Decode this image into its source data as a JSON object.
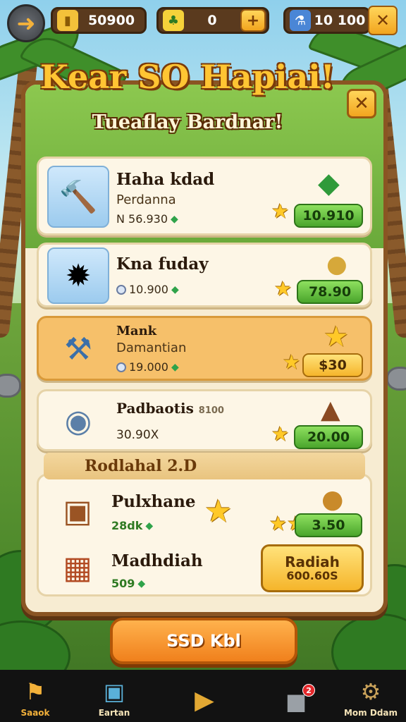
{
  "topbar": {
    "back_icon": "back-arrow-icon",
    "resources": [
      {
        "icon": "gold-bar-icon",
        "value": "50900"
      },
      {
        "icon": "corn-icon",
        "value": "0"
      },
      {
        "icon": "potion-icon",
        "value": "10 100"
      }
    ],
    "plus_label": "+",
    "close_label": "✕"
  },
  "panel": {
    "title": "Kear SO Hapiai!",
    "subtitle": "Tueaflay Bardnar!",
    "close_label": "✕"
  },
  "items": [
    {
      "name": "Haha kdad",
      "sub": "Perdanna",
      "cost": "N 56.930",
      "price": "10.910",
      "icon": "hammer-tool-icon"
    },
    {
      "name": "Kna fuday",
      "sub": "",
      "cost": "10.900",
      "price": "78.90",
      "icon": "orange-crystal-icon"
    },
    {
      "name": "Mank",
      "sub": "Damantian",
      "cost": "19.000",
      "price": "$30",
      "icon": "crossed-tools-icon"
    },
    {
      "name": "Padbaotis",
      "sub": "8100",
      "cost": "30.90X",
      "price": "20.00",
      "icon": "round-shield-icon"
    }
  ],
  "section_banner": "Rodlahal 2.D",
  "bottom_items": [
    {
      "name": "Pulxhane",
      "cost": "28dk",
      "price": "3.50",
      "icon": "treasure-barrel-icon"
    },
    {
      "name": "Madhdiah",
      "cost": "509",
      "icon": "treasure-chest-icon"
    }
  ],
  "radiah_button": {
    "line1": "Radiah",
    "line2": "600.60S"
  },
  "main_button": "SSD Kbl",
  "nav": [
    {
      "label": "Saaok",
      "icon": "flag-icon",
      "badge": ""
    },
    {
      "label": "Eartan",
      "icon": "cube-box-icon",
      "badge": ""
    },
    {
      "label": "",
      "icon": "play-triangle-icon",
      "badge": ""
    },
    {
      "label": "",
      "icon": "camera-icon",
      "badge": "2"
    },
    {
      "label": "Mom Ddam",
      "icon": "gear-icon",
      "badge": ""
    }
  ],
  "colors": {
    "panel_border": "#8a5523",
    "price_green": "#4aa52c",
    "accent_gold": "#f5b52b",
    "main_orange": "#f0801c"
  }
}
